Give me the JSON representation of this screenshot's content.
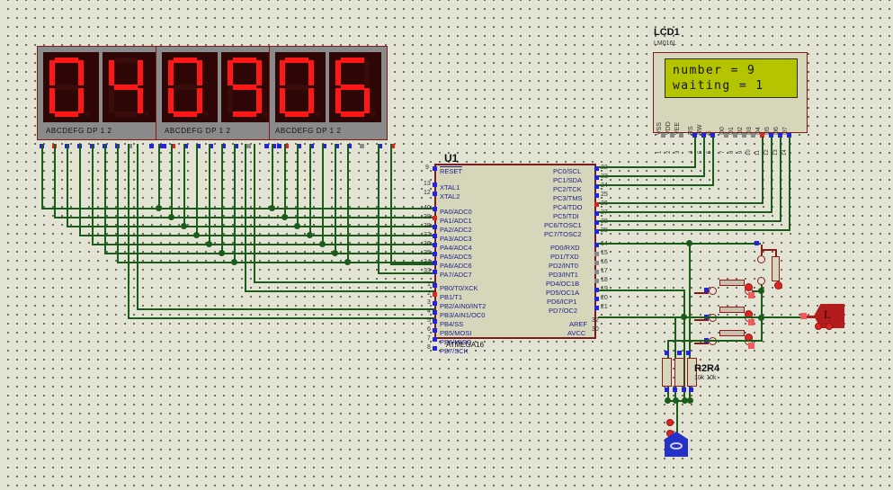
{
  "app": {
    "name": "Proteus ISIS Schematic Capture",
    "background_color": "#e2e3d3",
    "wire_color": "#1a5c1a",
    "body_color": "#d6d6bb",
    "outline_color": "#7d1b1b"
  },
  "displays": {
    "label_row": "ABCDEFG  DP    1 2",
    "pin_labels": [
      "A",
      "B",
      "C",
      "D",
      "E",
      "F",
      "G",
      "DP",
      "1",
      "2"
    ],
    "modules": [
      {
        "name": "display-left",
        "value": "04",
        "digits": [
          "0",
          "4"
        ]
      },
      {
        "name": "display-middle",
        "value": "09",
        "digits": [
          "0",
          "9"
        ]
      },
      {
        "name": "display-right",
        "value": "06",
        "digits": [
          "0",
          "6"
        ]
      }
    ],
    "segment_on_color": "#ff1717",
    "segment_off_color": "#3a0b0b"
  },
  "lcd": {
    "reference": "LCD1",
    "part_type": "LM016L",
    "screen_color": "#b5c400",
    "text_color": "#141400",
    "line1": "number = 9",
    "line2": "waiting = 1",
    "pin_labels": [
      "VSS",
      "VDD",
      "VEE",
      "RS",
      "RW",
      "E",
      "D0",
      "D1",
      "D2",
      "D3",
      "D4",
      "D5",
      "D6",
      "D7"
    ],
    "pin_numbers": [
      "1",
      "2",
      "3",
      "4",
      "5",
      "6",
      "7",
      "8",
      "9",
      "10",
      "11",
      "12",
      "13",
      "14"
    ]
  },
  "mcu": {
    "reference": "U1",
    "part_type": "ATMEGA16",
    "left_pins": [
      {
        "num": "9",
        "label": "RESET",
        "overline": true
      },
      {
        "num": "13",
        "label": "XTAL1",
        "overline": false
      },
      {
        "num": "12",
        "label": "XTAL2",
        "overline": false
      },
      {
        "num": "40",
        "label": "PA0/ADC0",
        "overline": false
      },
      {
        "num": "39",
        "label": "PA1/ADC1",
        "overline": false
      },
      {
        "num": "38",
        "label": "PA2/ADC2",
        "overline": false
      },
      {
        "num": "37",
        "label": "PA3/ADC3",
        "overline": false
      },
      {
        "num": "36",
        "label": "PA4/ADC4",
        "overline": false
      },
      {
        "num": "35",
        "label": "PA5/ADC5",
        "overline": false
      },
      {
        "num": "34",
        "label": "PA6/ADC6",
        "overline": false
      },
      {
        "num": "33",
        "label": "PA7/ADC7",
        "overline": false
      },
      {
        "num": "1",
        "label": "PB0/T0/XCK",
        "overline": false
      },
      {
        "num": "2",
        "label": "PB1/T1",
        "overline": false
      },
      {
        "num": "3",
        "label": "PB2/AIN0/INT2",
        "overline": false
      },
      {
        "num": "4",
        "label": "PB3/AIN1/OC0",
        "overline": false
      },
      {
        "num": "5",
        "label": "PB4/SS",
        "overline": false
      },
      {
        "num": "6",
        "label": "PB5/MOSI",
        "overline": false
      },
      {
        "num": "7",
        "label": "PB6/MISO",
        "overline": false
      },
      {
        "num": "8",
        "label": "PB7/SCK",
        "overline": false
      }
    ],
    "right_pins": [
      {
        "num": "22",
        "label": "PC0/SCL"
      },
      {
        "num": "23",
        "label": "PC1/SDA"
      },
      {
        "num": "24",
        "label": "PC2/TCK"
      },
      {
        "num": "25",
        "label": "PC3/TMS"
      },
      {
        "num": "26",
        "label": "PC4/TDO"
      },
      {
        "num": "27",
        "label": "PC5/TDI"
      },
      {
        "num": "28",
        "label": "PC6/TOSC1"
      },
      {
        "num": "29",
        "label": "PC7/TOSC2"
      },
      {
        "num": "14",
        "label": "PD0/RXD"
      },
      {
        "num": "15",
        "label": "PD1/TXD"
      },
      {
        "num": "16",
        "label": "PD2/INT0"
      },
      {
        "num": "17",
        "label": "PD3/INT1"
      },
      {
        "num": "18",
        "label": "PD4/OC1B"
      },
      {
        "num": "19",
        "label": "PD5/OC1A"
      },
      {
        "num": "20",
        "label": "PD6/ICP1"
      },
      {
        "num": "21",
        "label": "PD7/OC2"
      },
      {
        "num": "32",
        "label": "AREF"
      },
      {
        "num": "30",
        "label": "AVCC"
      }
    ]
  },
  "resistor_pack": {
    "reference": "R2R4",
    "value": "10k 10k"
  },
  "components": {
    "switch_count": 3,
    "pullup_switch": "top-switch",
    "lamp_name": "lamp-load",
    "ground_name": "ground-symbol"
  }
}
